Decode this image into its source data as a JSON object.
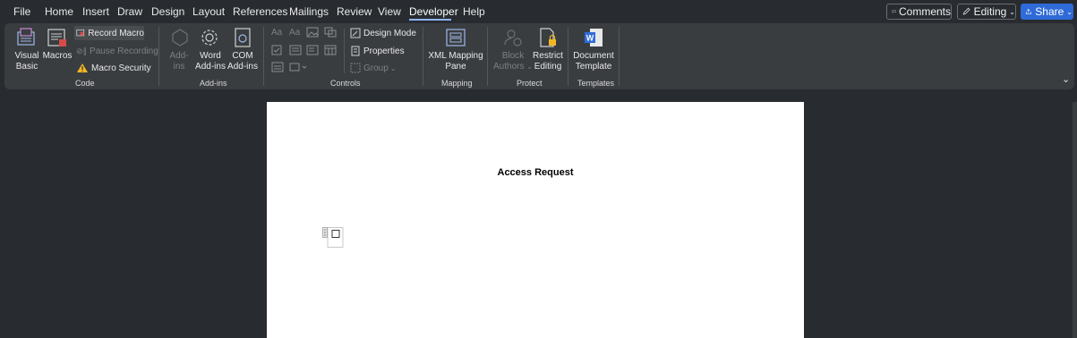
{
  "menu": {
    "file": "File",
    "home": "Home",
    "insert": "Insert",
    "draw": "Draw",
    "design": "Design",
    "layout": "Layout",
    "references": "References",
    "mailings": "Mailings",
    "review": "Review",
    "view": "View",
    "developer": "Developer",
    "help": "Help"
  },
  "topbar": {
    "comments": "Comments",
    "editing": "Editing",
    "share": "Share"
  },
  "ribbon": {
    "code": {
      "visual_basic_1": "Visual",
      "visual_basic_2": "Basic",
      "macros": "Macros",
      "record_macro": "Record Macro",
      "pause_recording": "Pause Recording",
      "macro_security": "Macro Security",
      "label": "Code"
    },
    "addins": {
      "addins_1": "Add-",
      "addins_2": "ins",
      "word_1": "Word",
      "word_2": "Add-ins",
      "com_1": "COM",
      "com_2": "Add-ins",
      "label": "Add-ins"
    },
    "controls": {
      "design_mode": "Design Mode",
      "properties": "Properties",
      "group": "Group",
      "label": "Controls",
      "aa1": "Aa",
      "aa2": "Aa"
    },
    "mapping": {
      "xml_1": "XML Mapping",
      "xml_2": "Pane",
      "label": "Mapping"
    },
    "protect": {
      "block_1": "Block",
      "block_2": "Authors",
      "restrict_1": "Restrict",
      "restrict_2": "Editing",
      "label": "Protect"
    },
    "templates": {
      "doc_1": "Document",
      "doc_2": "Template",
      "label": "Templates"
    }
  },
  "document": {
    "title": "Access Request"
  },
  "colors": {
    "accent": "#2f6bd8",
    "background": "#282c30",
    "ribbon": "#3a3d40",
    "warning": "#f2b824"
  }
}
